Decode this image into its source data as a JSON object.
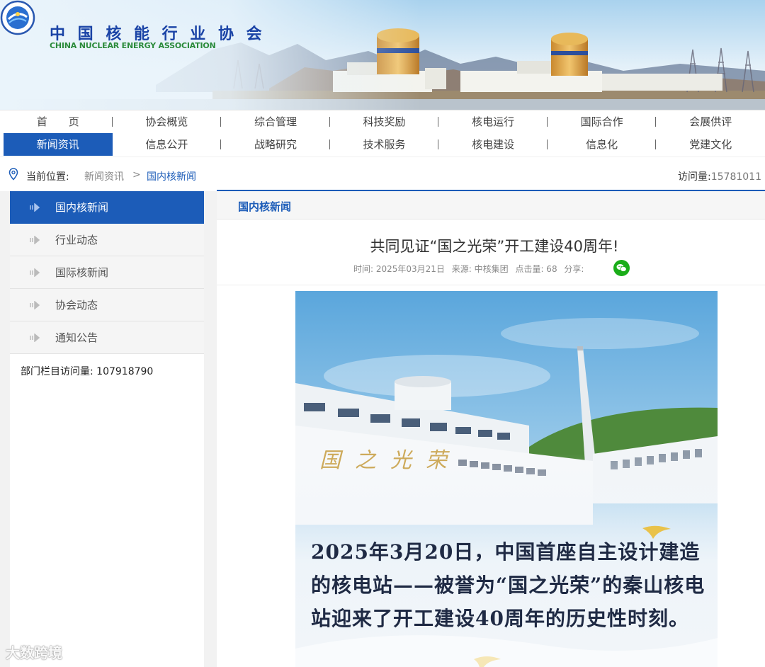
{
  "header": {
    "org_name_cn": "中 国 核 能 行 业 协 会",
    "org_name_en": "CHINA NUCLEAR ENERGY ASSOCIATION"
  },
  "nav": {
    "row1": [
      "首　　页",
      "协会概览",
      "综合管理",
      "科技奖励",
      "核电运行",
      "国际合作",
      "会展供评"
    ],
    "row2": [
      "新闻资讯",
      "信息公开",
      "战略研究",
      "技术服务",
      "核电建设",
      "信息化",
      "党建文化"
    ],
    "active": "新闻资讯"
  },
  "breadcrumb": {
    "label": "当前位置:",
    "level1": "新闻资讯",
    "separator": ">",
    "level2": "国内核新闻",
    "visits_label": "访问量:",
    "visits_value": "15781011"
  },
  "sidebar": {
    "items": [
      {
        "label": "国内核新闻",
        "active": true
      },
      {
        "label": "行业动态",
        "active": false
      },
      {
        "label": "国际核新闻",
        "active": false
      },
      {
        "label": "协会动态",
        "active": false
      },
      {
        "label": "通知公告",
        "active": false
      }
    ],
    "dept_visits": "部门栏目访问量: 107918790"
  },
  "main": {
    "section_title": "国内核新闻",
    "article": {
      "title": "共同见证“国之光荣”开工建设40周年!",
      "time": "时间: 2025年03月21日",
      "source": "来源: 中核集团",
      "clicks": "点击量: 68",
      "share": "分享:"
    },
    "poster": {
      "calligraphy": "国之光荣",
      "text": "2025年3月20日，中国首座自主设计建造的核电站——被誉为“国之光荣”的秦山核电站迎来了开工建设40周年的历史性时刻。"
    }
  },
  "watermark": "大数跨境",
  "colors": {
    "accent": "#1c5cb8",
    "logo_blue": "#1a43a6",
    "logo_green": "#2a8a3a",
    "wechat": "#1aad19"
  },
  "icons": [
    "location-pin-icon",
    "sidebar-arrow-icon",
    "wechat-icon",
    "logo-emblem-icon"
  ]
}
